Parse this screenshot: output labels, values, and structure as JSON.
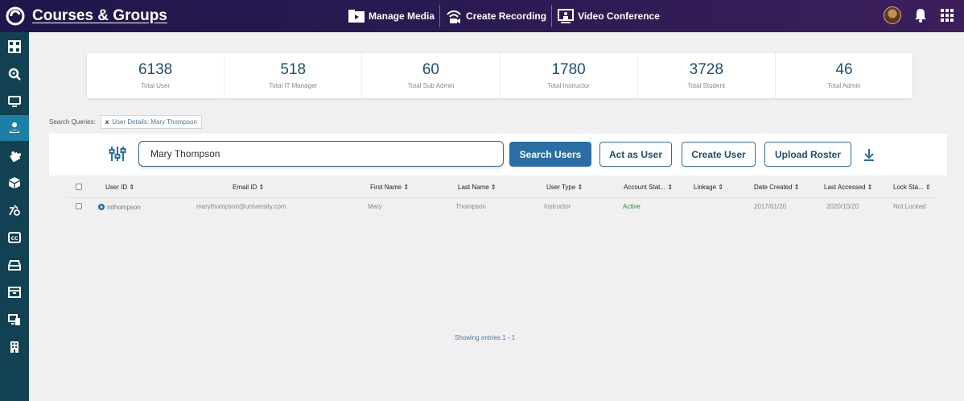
{
  "header": {
    "title": "Courses & Groups",
    "nav": [
      {
        "label": "Manage Media",
        "icon": "media-icon"
      },
      {
        "label": "Create Recording",
        "icon": "recording-icon"
      },
      {
        "label": "Video Conference",
        "icon": "video-conference-icon"
      }
    ],
    "right_icons": [
      "avatar",
      "bell-icon",
      "apps-grid-icon"
    ]
  },
  "sidebar": {
    "items": [
      {
        "icon": "dashboard-icon",
        "active": false
      },
      {
        "icon": "search-icon",
        "active": false
      },
      {
        "icon": "monitor-icon",
        "active": false
      },
      {
        "icon": "users-icon",
        "active": true
      },
      {
        "icon": "puzzle-icon",
        "active": false
      },
      {
        "icon": "cube-icon",
        "active": false
      },
      {
        "icon": "shapes-icon",
        "active": false
      },
      {
        "icon": "closed-caption-icon",
        "active": false
      },
      {
        "icon": "drive-icon",
        "active": false
      },
      {
        "icon": "archive-icon",
        "active": false
      },
      {
        "icon": "devices-icon",
        "active": false
      },
      {
        "icon": "building-icon",
        "active": false
      }
    ]
  },
  "stats": [
    {
      "value": "6138",
      "label": "Total User"
    },
    {
      "value": "518",
      "label": "Total IT Manager"
    },
    {
      "value": "60",
      "label": "Total Sub Admin"
    },
    {
      "value": "1780",
      "label": "Total Instructor"
    },
    {
      "value": "3728",
      "label": "Total Student"
    },
    {
      "value": "46",
      "label": "Total Admin"
    }
  ],
  "queries": {
    "label": "Search Queries:",
    "chip_remove": "x",
    "chip": "User Details: Mary Thompson"
  },
  "search": {
    "value": "Mary Thompson",
    "search_button": "Search Users",
    "act_as_user": "Act as User",
    "create_user": "Create User",
    "upload_roster": "Upload Roster"
  },
  "table": {
    "headers": [
      "User ID ⇕",
      "Email ID ⇕",
      "First Name ⇕",
      "Last Name ⇕",
      "User Type ⇕",
      "Account Stat... ⇕",
      "Linkage ⇕",
      "Date Created ⇕",
      "Last Accessed ⇕",
      "Lock Sta... ⇕"
    ],
    "rows": [
      {
        "user_id": "mthompson",
        "email": "marythompson@university.com",
        "first_name": "Mary",
        "last_name": "Thompson",
        "user_type": "Instructor",
        "account_status": "Active",
        "linkage": "",
        "date_created": "2017/01/20",
        "last_accessed": "2020/10/20",
        "lock_status": "Not Locked"
      }
    ]
  },
  "footer": {
    "showing": "Showing entries 1 - 1"
  },
  "colors": {
    "topbar": "#20164a",
    "sidebar": "#114152",
    "sidebar_active": "#1e7fa6",
    "primary": "#2b6ea3",
    "stat_number": "#1c4f73",
    "status_active": "#2e8b3a"
  }
}
